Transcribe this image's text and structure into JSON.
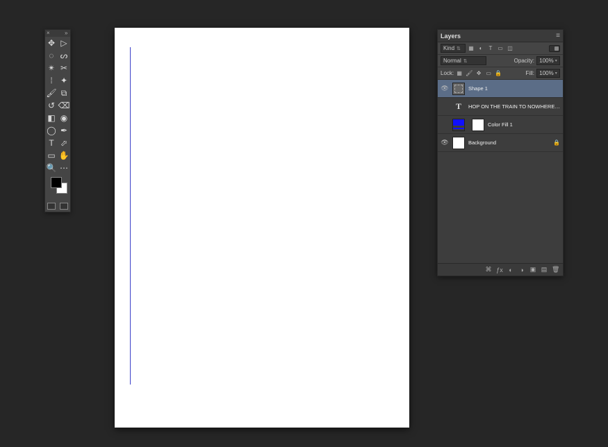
{
  "toolbox": {
    "tools": [
      {
        "id": "move",
        "glyph": "✥"
      },
      {
        "id": "artboard",
        "glyph": "▷"
      },
      {
        "id": "marquee",
        "glyph": "◌"
      },
      {
        "id": "lasso",
        "glyph": "ᔕ"
      },
      {
        "id": "magic-wand",
        "glyph": "✴"
      },
      {
        "id": "crop",
        "glyph": "✂"
      },
      {
        "id": "eyedropper",
        "glyph": "⁞"
      },
      {
        "id": "spot-heal",
        "glyph": "✦"
      },
      {
        "id": "brush",
        "glyph": "🖌"
      },
      {
        "id": "clone",
        "glyph": "⧉"
      },
      {
        "id": "history-brush",
        "glyph": "↺"
      },
      {
        "id": "eraser",
        "glyph": "⌫"
      },
      {
        "id": "gradient",
        "glyph": "◧"
      },
      {
        "id": "blur",
        "glyph": "◉"
      },
      {
        "id": "dodge",
        "glyph": "◯"
      },
      {
        "id": "pen",
        "glyph": "✒"
      },
      {
        "id": "type",
        "glyph": "T"
      },
      {
        "id": "path-select",
        "glyph": "⬀"
      },
      {
        "id": "rectangle",
        "glyph": "▭"
      },
      {
        "id": "hand",
        "glyph": "✋"
      },
      {
        "id": "zoom",
        "glyph": "🔍"
      },
      {
        "id": "extra",
        "glyph": "⋯"
      }
    ],
    "swatches": {
      "fg": "#000000",
      "bg": "#ffffff"
    }
  },
  "layers_panel": {
    "title": "Layers",
    "filter": {
      "kind_label": "Kind"
    },
    "blend": {
      "mode_label": "Normal",
      "opacity_label": "Opacity:",
      "opacity_value": "100%"
    },
    "lock": {
      "label": "Lock:",
      "fill_label": "Fill:",
      "fill_value": "100%"
    },
    "layers": [
      {
        "name": "Shape 1",
        "kind": "shape",
        "visible": true,
        "selected": true,
        "locked": false
      },
      {
        "name": "HOP ON THE TRAIN TO NOWHERE BABY",
        "kind": "text",
        "visible": false,
        "selected": false,
        "locked": false
      },
      {
        "name": "Color Fill 1",
        "kind": "fill",
        "visible": false,
        "selected": false,
        "locked": false
      },
      {
        "name": "Background",
        "kind": "bg",
        "visible": true,
        "selected": false,
        "locked": true
      }
    ]
  }
}
